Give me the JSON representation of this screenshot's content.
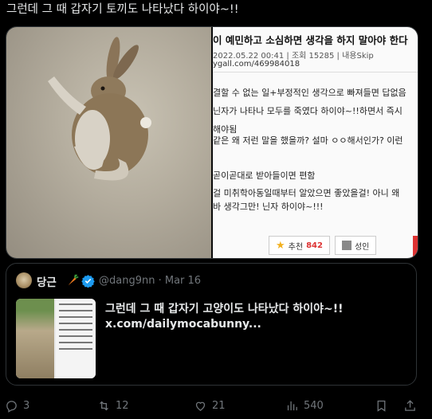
{
  "post": {
    "text": "그런데 그 때 갑자기 토끼도 나타났다 하이야~!!"
  },
  "media": {
    "screenshot": {
      "title": "이 예민하고 소심하면 생각을 하지 말아야 한다",
      "meta": "2022.05.22 00:41 | 조회 15285 | 내용Skip",
      "link": "ygall.com/469984018",
      "lines": [
        "결할 수 없는 일+부정적인 생각으로 빠져들면 답없음",
        "닌자가 나타나 모두를 죽였다 하이야~!!하면서 즉시",
        "해야됨",
        "같은 왜 저런 말을 했을까? 설마 ㅇㅇ해서인가? 이런",
        "",
        "곧이곧대로 받아들이면 편함",
        "걸 미취학아동일때부터 알았으면 좋았을걸! 아니 왜",
        "바 생각그만! 닌자 하이야~!!!"
      ],
      "recommend_label": "추천",
      "recommend_count": "842",
      "nonrecommend_label": "성인"
    }
  },
  "quote": {
    "name": "당근",
    "handle": "@dang9nn · Mar 16",
    "text": "그런데 그 때 갑자기 고양이도 나타났다 하이야~!!",
    "link": "x.com/dailymocabunny..."
  },
  "actions": {
    "replies": "3",
    "reposts": "12",
    "likes": "21",
    "views": "540"
  },
  "colors": {
    "background": "#000000",
    "text": "#e7e9ea",
    "muted": "#71767b",
    "verified": "#1d9bf0"
  }
}
